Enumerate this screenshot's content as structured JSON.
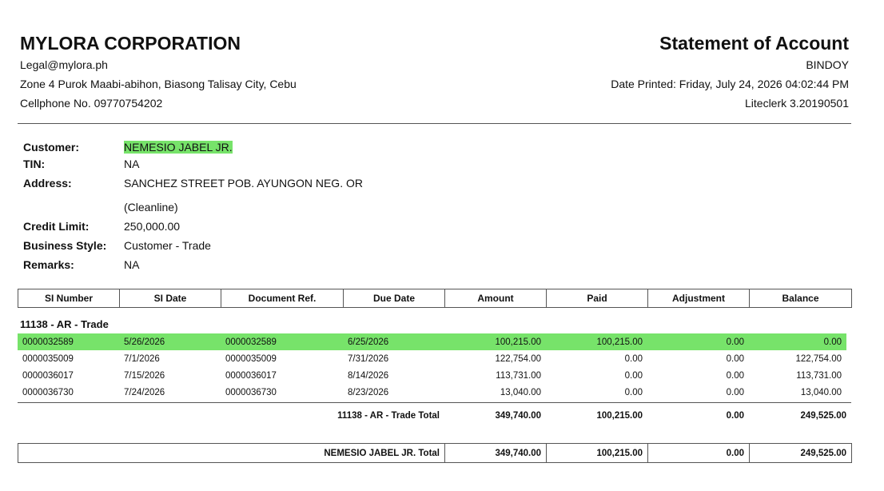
{
  "header": {
    "company": "MYLORA CORPORATION",
    "email": "Legal@mylora.ph",
    "address": "Zone 4 Purok Maabi-abihon, Biasong Talisay City, Cebu",
    "phone": "Cellphone No. 09770754202",
    "title": "Statement of Account",
    "branch": "BINDOY",
    "date_printed": "Date Printed: Friday, July 24, 2026 04:02:44 PM",
    "version": "Liteclerk 3.20190501"
  },
  "customer": {
    "customer_label": "Customer:",
    "customer_value": "NEMESIO JABEL JR.",
    "tin_label": "TIN:",
    "tin_value": "NA",
    "address_label": "Address:",
    "address_line1": "SANCHEZ STREET POB. AYUNGON NEG. OR",
    "address_line2": "(Cleanline)",
    "credit_label": "Credit Limit:",
    "credit_value": "250,000.00",
    "style_label": "Business Style:",
    "style_value": "Customer - Trade",
    "remarks_label": "Remarks:",
    "remarks_value": "NA"
  },
  "table": {
    "columns": [
      "SI Number",
      "SI Date",
      "Document Ref.",
      "Due Date",
      "Amount",
      "Paid",
      "Adjustment",
      "Balance"
    ],
    "group": "11138 - AR - Trade",
    "rows": [
      [
        "0000032589",
        "5/26/2026",
        "0000032589",
        "6/25/2026",
        "100,215.00",
        "100,215.00",
        "0.00",
        "0.00"
      ],
      [
        "0000035009",
        "7/1/2026",
        "0000035009",
        "7/31/2026",
        "122,754.00",
        "0.00",
        "0.00",
        "122,754.00"
      ],
      [
        "0000036017",
        "7/15/2026",
        "0000036017",
        "8/14/2026",
        "113,731.00",
        "0.00",
        "0.00",
        "113,731.00"
      ],
      [
        "0000036730",
        "7/24/2026",
        "0000036730",
        "8/23/2026",
        "13,040.00",
        "0.00",
        "0.00",
        "13,040.00"
      ]
    ],
    "group_total": {
      "label": "11138 - AR - Trade Total",
      "amount": "349,740.00",
      "paid": "100,215.00",
      "adjustment": "0.00",
      "balance": "249,525.00"
    },
    "grand_total": {
      "label": "NEMESIO JABEL JR. Total",
      "amount": "349,740.00",
      "paid": "100,215.00",
      "adjustment": "0.00",
      "balance": "249,525.00"
    }
  },
  "colors": {
    "highlight": "#77e36a"
  }
}
